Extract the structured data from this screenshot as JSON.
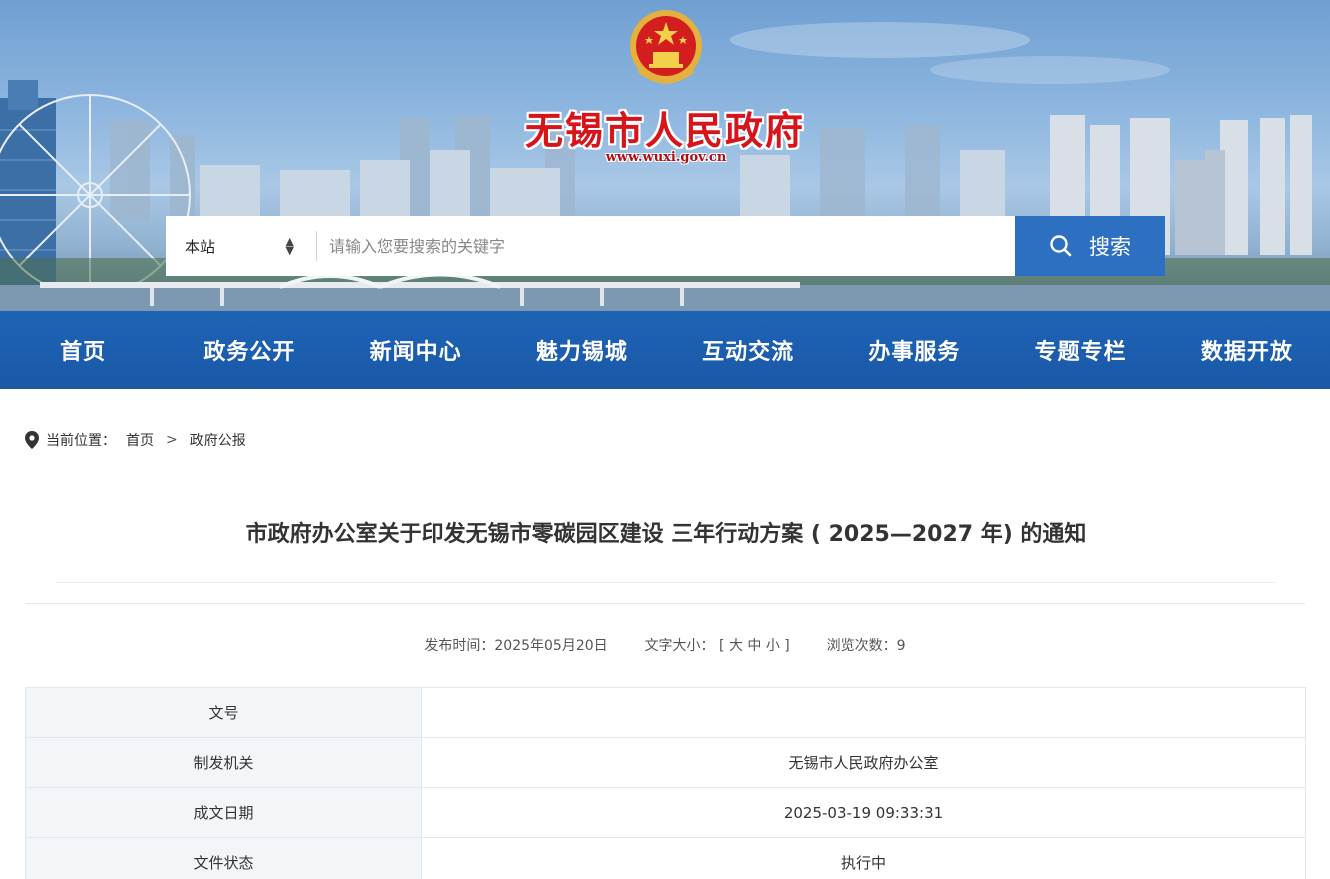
{
  "header": {
    "site_title": "无锡市人民政府",
    "site_url": "www.wuxi.gov.cn"
  },
  "search": {
    "scope": "本站",
    "placeholder": "请输入您要搜索的关键字",
    "button_label": "搜索"
  },
  "nav": {
    "items": [
      "首页",
      "政务公开",
      "新闻中心",
      "魅力锡城",
      "互动交流",
      "办事服务",
      "专题专栏",
      "数据开放"
    ]
  },
  "breadcrumb": {
    "prefix": "当前位置：",
    "items": [
      "首页",
      "政府公报"
    ],
    "separator": ">"
  },
  "article": {
    "title": "市政府办公室关于印发无锡市零碳园区建设 三年行动方案 ( 2025—2027 年) 的通知",
    "publish_label": "发布时间：",
    "publish_date": "2025年05月20日",
    "font_size_label": "文字大小：",
    "font_size_open": "[",
    "font_large": "大",
    "font_medium": "中",
    "font_small": "小",
    "font_size_close": "]",
    "views_label": "浏览次数：",
    "views": "9"
  },
  "info_table": [
    {
      "key": "文号",
      "value": ""
    },
    {
      "key": "制发机关",
      "value": "无锡市人民政府办公室"
    },
    {
      "key": "成文日期",
      "value": "2025-03-19 09:33:31"
    },
    {
      "key": "文件状态",
      "value": "执行中"
    }
  ],
  "colors": {
    "nav_bg": "#1e63b5",
    "search_button": "#2d6fc1",
    "title_red": "#d8141a"
  }
}
